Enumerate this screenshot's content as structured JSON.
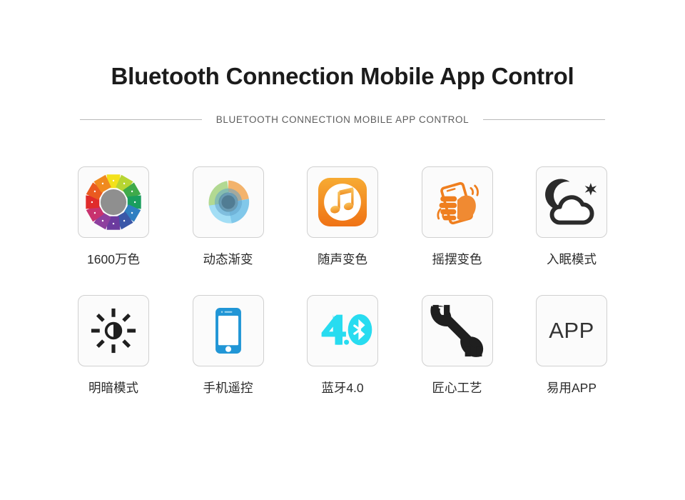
{
  "header": {
    "title": "Bluetooth Connection Mobile App Control",
    "subtitle": "BLUETOOTH CONNECTION MOBILE APP CONTROL"
  },
  "colors": {
    "title_text": "#1b1b1b",
    "subtitle_text": "#5d5d5d",
    "rule": "#b9b9b9",
    "tile_border": "#d0d0d0",
    "tile_bg": "#fbfbfb",
    "label_text": "#2b2b2b",
    "orange": "#ef7f1f",
    "orange_light": "#f7a83c",
    "cyan": "#28dcf0",
    "blue_phone": "#2196d6",
    "black_icon": "#1f1f1f",
    "wheel_center": "#8f8f8f",
    "app_text": "#333333"
  },
  "features": {
    "row1": [
      {
        "icon": "color-wheel-icon",
        "label": "1600万色"
      },
      {
        "icon": "gradient-swirl-icon",
        "label": "动态渐变"
      },
      {
        "icon": "music-note-icon",
        "label": "随声变色"
      },
      {
        "icon": "shake-phone-icon",
        "label": "摇摆变色"
      },
      {
        "icon": "moon-cloud-icon",
        "label": "入眠模式"
      }
    ],
    "row2": [
      {
        "icon": "brightness-icon",
        "label": "明暗模式"
      },
      {
        "icon": "smartphone-icon",
        "label": "手机遥控"
      },
      {
        "icon": "bluetooth-40-icon",
        "label": "蓝牙4.0"
      },
      {
        "icon": "wrench-icon",
        "label": "匠心工艺"
      },
      {
        "icon": "app-text-icon",
        "label": "易用APP",
        "text": "APP"
      }
    ]
  },
  "color_wheel": {
    "segments": [
      "#f3e11b",
      "#b7d532",
      "#3faa4a",
      "#1a9e5e",
      "#2f7fc1",
      "#3a57a8",
      "#6b3b9e",
      "#8e3f9e",
      "#c8326e",
      "#e02b2b",
      "#ea5a20",
      "#f08a1e"
    ],
    "center": "#8f8f8f"
  }
}
